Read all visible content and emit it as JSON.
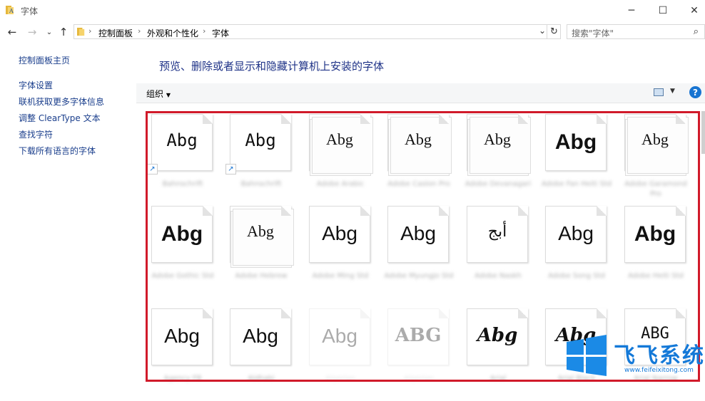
{
  "window": {
    "title": "字体"
  },
  "nav": {
    "breadcrumbs": [
      "控制面板",
      "外观和个性化",
      "字体"
    ],
    "search_placeholder": "搜索\"字体\""
  },
  "sidebar": {
    "home": "控制面板主页",
    "links": [
      "字体设置",
      "联机获取更多字体信息",
      "调整 ClearType 文本",
      "查找字符",
      "下载所有语言的字体"
    ]
  },
  "main": {
    "heading": "预览、删除或者显示和隐藏计算机上安装的字体",
    "organize_label": "组织",
    "help_label": "?"
  },
  "fonts": [
    {
      "sample": "Abg",
      "name": "Bahnschrift",
      "style": "mono",
      "kind": "single",
      "shortcut": true
    },
    {
      "sample": "Abg",
      "name": "Bahnschrift",
      "style": "mono",
      "kind": "single",
      "shortcut": true
    },
    {
      "sample": "Abg",
      "name": "Adobe Arabic",
      "style": "serif",
      "kind": "stack",
      "shortcut": false
    },
    {
      "sample": "Abg",
      "name": "Adobe Caslon Pro",
      "style": "serif",
      "kind": "stack",
      "shortcut": false
    },
    {
      "sample": "Abg",
      "name": "Adobe Devanagari",
      "style": "serif",
      "kind": "stack",
      "shortcut": false
    },
    {
      "sample": "Abg",
      "name": "Adobe Fan Heiti Std",
      "style": "bold",
      "kind": "single",
      "shortcut": false
    },
    {
      "sample": "Abg",
      "name": "Adobe Garamond Pro",
      "style": "serif",
      "kind": "stack",
      "shortcut": false
    },
    {
      "sample": "Abg",
      "name": "Adobe Gothic Std",
      "style": "bold",
      "kind": "single",
      "shortcut": false
    },
    {
      "sample": "Abg",
      "name": "Adobe Hebrew",
      "style": "serif",
      "kind": "stack",
      "shortcut": false
    },
    {
      "sample": "Abg",
      "name": "Adobe Ming Std",
      "style": "light",
      "kind": "single",
      "shortcut": false
    },
    {
      "sample": "Abg",
      "name": "Adobe Myungjo Std",
      "style": "light",
      "kind": "single",
      "shortcut": false
    },
    {
      "sample": "أبج",
      "name": "Adobe Naskh",
      "style": "serif",
      "kind": "single",
      "shortcut": false
    },
    {
      "sample": "Abg",
      "name": "Adobe Song Std",
      "style": "light",
      "kind": "single",
      "shortcut": false
    },
    {
      "sample": "Abg",
      "name": "Adobe Heiti Std",
      "style": "bold",
      "kind": "single",
      "shortcut": false
    },
    {
      "sample": "Abg",
      "name": "Agency FB",
      "style": "light",
      "kind": "single",
      "shortcut": false
    },
    {
      "sample": "Abg",
      "name": "Aldhabi",
      "style": "light",
      "kind": "single",
      "shortcut": false
    },
    {
      "sample": "Abg",
      "name": "Algerian",
      "style": "light",
      "kind": "single",
      "shortcut": false,
      "faded": true
    },
    {
      "sample": "ABG",
      "name": "Algerian",
      "style": "serif-caps",
      "kind": "single",
      "shortcut": false,
      "faded": true
    },
    {
      "sample": "Abg",
      "name": "Arial",
      "style": "italic-bold",
      "kind": "single",
      "shortcut": false
    },
    {
      "sample": "Abg",
      "name": "Arial Black",
      "style": "italic-bold",
      "kind": "single",
      "shortcut": false
    },
    {
      "sample": "ABG",
      "name": "Arial Narrow",
      "style": "mono-caps",
      "kind": "single",
      "shortcut": false
    }
  ],
  "watermark": {
    "brand": "飞飞系统",
    "url": "www.feifeixitong.com"
  }
}
